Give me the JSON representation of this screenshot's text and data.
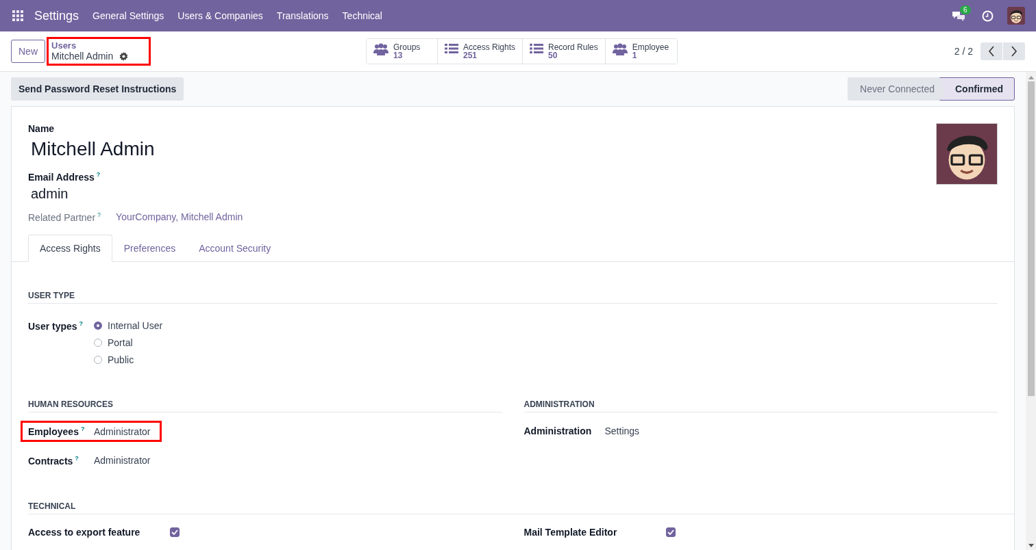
{
  "navbar": {
    "app_name": "Settings",
    "menus": [
      "General Settings",
      "Users & Companies",
      "Translations",
      "Technical"
    ],
    "messages_count": "6"
  },
  "control_panel": {
    "new_button": "New",
    "breadcrumb": {
      "parent": "Users",
      "current": "Mitchell Admin",
      "highlighted": true
    },
    "stat_buttons": [
      {
        "kind": "people",
        "label": "Groups",
        "value": "13"
      },
      {
        "kind": "lines",
        "label": "Access Rights",
        "value": "251"
      },
      {
        "kind": "bullets",
        "label": "Record Rules",
        "value": "50"
      },
      {
        "kind": "people",
        "label": "Employee",
        "value": "1"
      }
    ],
    "pager": "2 / 2"
  },
  "action_button": "Send Password Reset Instructions",
  "status_bar": [
    {
      "label": "Never Connected",
      "selected": false
    },
    {
      "label": "Confirmed",
      "selected": true
    }
  ],
  "form": {
    "name_label": "Name",
    "name": "Mitchell Admin",
    "email_label": "Email Address",
    "email_help": "?",
    "email": "admin",
    "partner_label": "Related Partner",
    "partner_help": "?",
    "partner": "YourCompany, Mitchell Admin",
    "tabs": [
      {
        "label": "Access Rights",
        "selected": true
      },
      {
        "label": "Preferences",
        "selected": false
      },
      {
        "label": "Account Security",
        "selected": false
      }
    ],
    "user_type": {
      "title": "USER TYPE",
      "label": "User types",
      "help": "?",
      "options": [
        {
          "label": "Internal User",
          "selected": true
        },
        {
          "label": "Portal",
          "selected": false
        },
        {
          "label": "Public",
          "selected": false
        }
      ]
    },
    "human_resources": {
      "title": "HUMAN RESOURCES",
      "fields": [
        {
          "label": "Employees",
          "help": "?",
          "value": "Administrator",
          "highlighted": true
        },
        {
          "label": "Contracts",
          "help": "?",
          "value": "Administrator",
          "highlighted": false
        }
      ]
    },
    "administration": {
      "title": "ADMINISTRATION",
      "fields": [
        {
          "label": "Administration",
          "value": "Settings",
          "highlighted": false
        }
      ]
    },
    "technical": {
      "title": "TECHNICAL",
      "items": [
        {
          "label": "Access to export feature",
          "checked": true
        },
        {
          "label": "Mail Template Editor",
          "checked": true
        }
      ]
    }
  }
}
